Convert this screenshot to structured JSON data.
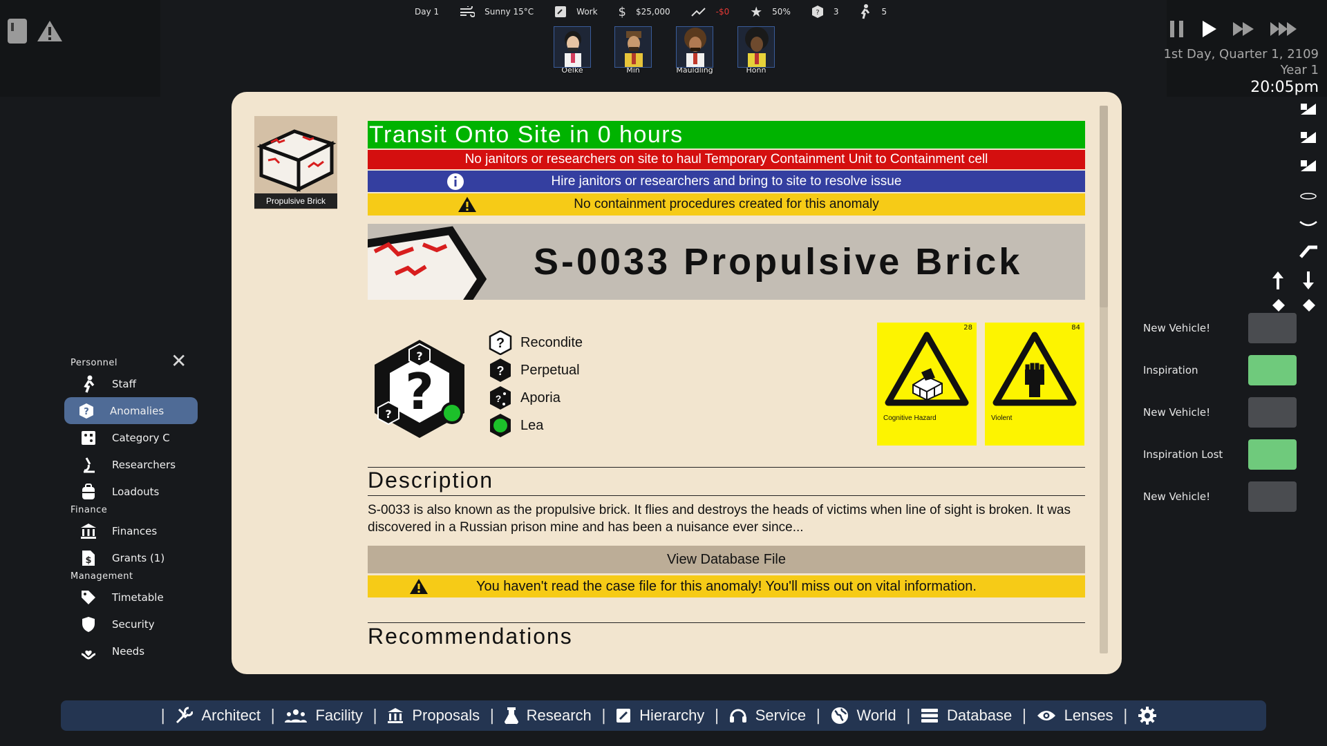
{
  "top_bar": {
    "day": "Day 1",
    "weather": "Sunny 15°C",
    "schedule": "Work",
    "money": "$25,000",
    "money_change": "-$0",
    "reputation": "50%",
    "anomaly_count": "3",
    "staff_count": "5"
  },
  "characters": [
    {
      "name": "Oelke"
    },
    {
      "name": "Min"
    },
    {
      "name": "Mauldling"
    },
    {
      "name": "Honn"
    }
  ],
  "clock": {
    "date": "1st Day, Quarter 1, 2109",
    "year": "Year 1",
    "time": "20:05pm"
  },
  "notifications": [
    {
      "label": "New Vehicle!",
      "state": "gray"
    },
    {
      "label": "Inspiration",
      "state": "green"
    },
    {
      "label": "New Vehicle!",
      "state": "gray"
    },
    {
      "label": "Inspiration Lost",
      "state": "green"
    },
    {
      "label": "New Vehicle!",
      "state": "gray"
    }
  ],
  "left_menu": {
    "sections": {
      "personnel": "Personnel",
      "finance": "Finance",
      "management": "Management"
    },
    "items": {
      "staff": "Staff",
      "anomalies": "Anomalies",
      "category_c": "Category C",
      "researchers": "Researchers",
      "loadouts": "Loadouts",
      "finances": "Finances",
      "grants": "Grants (1)",
      "timetable": "Timetable",
      "security": "Security",
      "needs": "Needs"
    }
  },
  "anomaly": {
    "thumb_caption": "Propulsive Brick",
    "transit": "Transit Onto Site in 0 hours",
    "no_janitors": "No janitors or researchers on site to haul Temporary Containment Unit to Containment cell",
    "hire": "Hire janitors or researchers and bring to site to resolve issue",
    "no_procedures": "No containment procedures created for this anomaly",
    "title": "S-0033 Propulsive Brick",
    "traits": [
      "Recondite",
      "Perpetual",
      "Aporia",
      "Lea"
    ],
    "hazards": [
      {
        "number": "28",
        "label": "Cognitive Hazard"
      },
      {
        "number": "84",
        "label": "Violent"
      }
    ],
    "description_heading": "Description",
    "description": "S-0033 is also known as the propulsive brick. It flies and destroys the heads of victims when line of sight is broken. It was  discovered in a Russian prison mine and has been a nuisance ever since...",
    "view_db": "View Database File",
    "read_warning": "You haven't read the case file for this anomaly! You'll miss out on vital information.",
    "recommendations_heading": "Recommendations"
  },
  "bottom_bar": {
    "architect": "Architect",
    "facility": "Facility",
    "proposals": "Proposals",
    "research": "Research",
    "hierarchy": "Hierarchy",
    "service": "Service",
    "world": "World",
    "database": "Database",
    "lenses": "Lenses"
  },
  "colors": {
    "panel_bg": "#f2e5cf",
    "transit_green": "#00b300",
    "alert_red": "#d40f0f",
    "info_blue": "#343fa0",
    "warning_yellow": "#f6cb17",
    "hazard_yellow": "#fdf400",
    "menu_active": "#4f6b96",
    "bottom_bar": "#243551"
  }
}
